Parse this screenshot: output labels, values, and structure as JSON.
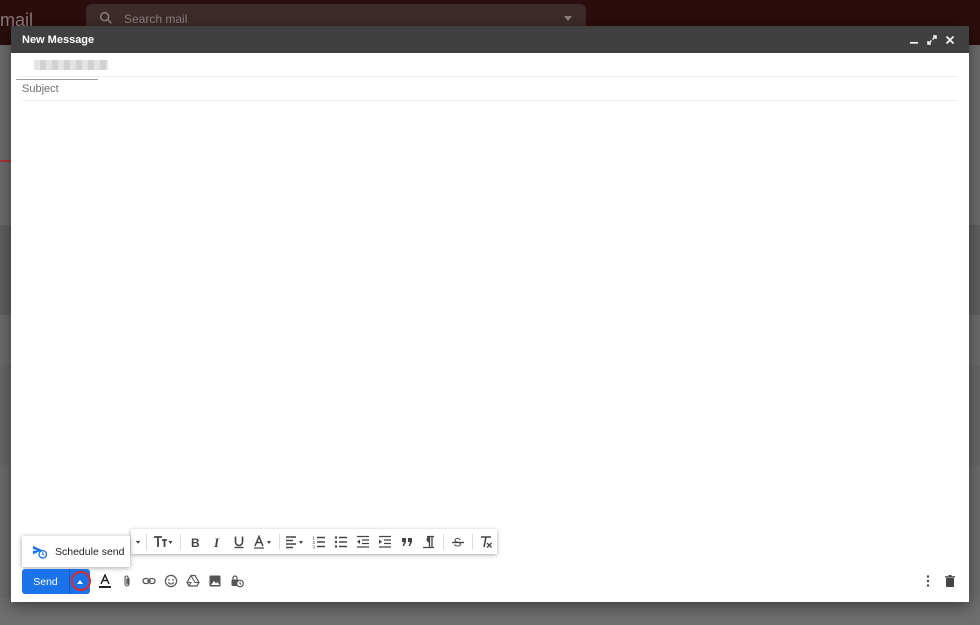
{
  "background": {
    "logo_text": "mail",
    "search_placeholder": "Search mail"
  },
  "compose": {
    "title": "New Message",
    "subject_placeholder": "Subject",
    "send_label": "Send",
    "schedule_send_label": "Schedule send"
  },
  "colors": {
    "accent": "#1a73e8",
    "header": "#404040",
    "highlight_ring": "#e0282a"
  },
  "icons": {
    "header": [
      "minimize-icon",
      "fullscreen-icon",
      "close-icon"
    ],
    "format_toolbar": [
      "dropdown-caret-icon",
      "text-size-icon",
      "bold-icon",
      "italic-icon",
      "underline-icon",
      "text-color-icon",
      "align-icon",
      "numbered-list-icon",
      "bulleted-list-icon",
      "indent-less-icon",
      "indent-more-icon",
      "quote-icon",
      "remove-formatting-icon",
      "strikethrough-icon",
      "clear-formatting-icon"
    ],
    "bottom_toolbar": [
      "formatting-options-icon",
      "attach-file-icon",
      "insert-link-icon",
      "emoji-icon",
      "google-drive-icon",
      "insert-photo-icon",
      "confidential-mode-icon",
      "more-options-icon",
      "discard-draft-icon"
    ]
  }
}
